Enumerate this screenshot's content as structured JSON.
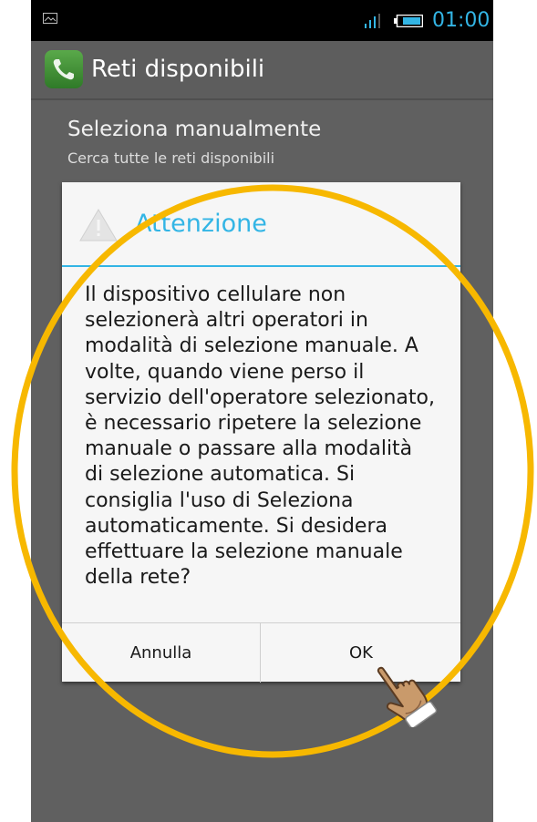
{
  "status_bar": {
    "time": "01:00",
    "time_color": "#33b5e5",
    "icons": [
      "image-notification-icon",
      "signal-icon",
      "battery-icon"
    ]
  },
  "action_bar": {
    "title": "Reti disponibili",
    "icon": "phone-app-icon"
  },
  "settings_list": {
    "item_title": "Seleziona manualmente",
    "item_subtitle": "Cerca tutte le reti disponibili"
  },
  "dialog": {
    "title": "Attenzione",
    "icon": "warning-icon",
    "accent_color": "#33b5e5",
    "message": "Il dispositivo cellulare non\nselezionerà altri operatori in\nmodalità di selezione manuale. A\nvolte, quando viene perso il\nservizio dell'operatore selezionato,\nè necessario ripetere la selezione\nmanuale o passare alla modalità\ndi selezione automatica. Si\nconsiglia l'uso di Seleziona\nautomaticamente. Si desidera\neffettuare la selezione manuale\ndella rete?",
    "cancel_label": "Annulla",
    "ok_label": "OK"
  },
  "annotations": {
    "highlight_color": "#f7b800",
    "pointer": "hand-pointer-icon"
  }
}
